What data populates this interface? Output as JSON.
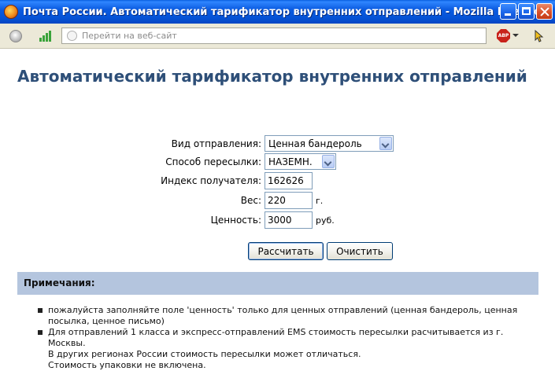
{
  "window": {
    "title": "Почта России. Автоматический тарификатор внутренних отправлений - Mozilla Firefox",
    "app_icon": "firefox-icon",
    "controls": [
      "minimize-icon",
      "maximize-icon",
      "close-icon"
    ]
  },
  "toolbar": {
    "address_placeholder": "Перейти на веб-сайт",
    "addon_label": "ABP"
  },
  "page": {
    "title": "Автоматический тарификатор внутренних отправлений",
    "form": {
      "type_label": "Вид отправления:",
      "type_value": "Ценная бандероль",
      "method_label": "Способ пересылки:",
      "method_value": "НАЗЕМН.",
      "index_label": "Индекс получателя:",
      "index_value": "162626",
      "weight_label": "Вес:",
      "weight_value": "220",
      "weight_unit": "г.",
      "value_label": "Ценность:",
      "value_value": "3000",
      "value_unit": "руб."
    },
    "buttons": {
      "calculate": "Рассчитать",
      "clear": "Очистить"
    },
    "notes": {
      "heading": "Примечания:",
      "items": [
        {
          "line1": "пожалуйста заполняйте поле 'ценность' только для ценных отправлений (ценная бандероль, ценная",
          "line2": "посылка, ценное письмо)"
        },
        {
          "line1": "Для отправлений 1 класса и экспресс-отправлений EMS стоимость пересылки расчитывается из г. Москвы.",
          "line2": "В других регионах России стоимость пересылки может отличаться.",
          "line3": "Стоимость упаковки не включена."
        }
      ]
    }
  }
}
